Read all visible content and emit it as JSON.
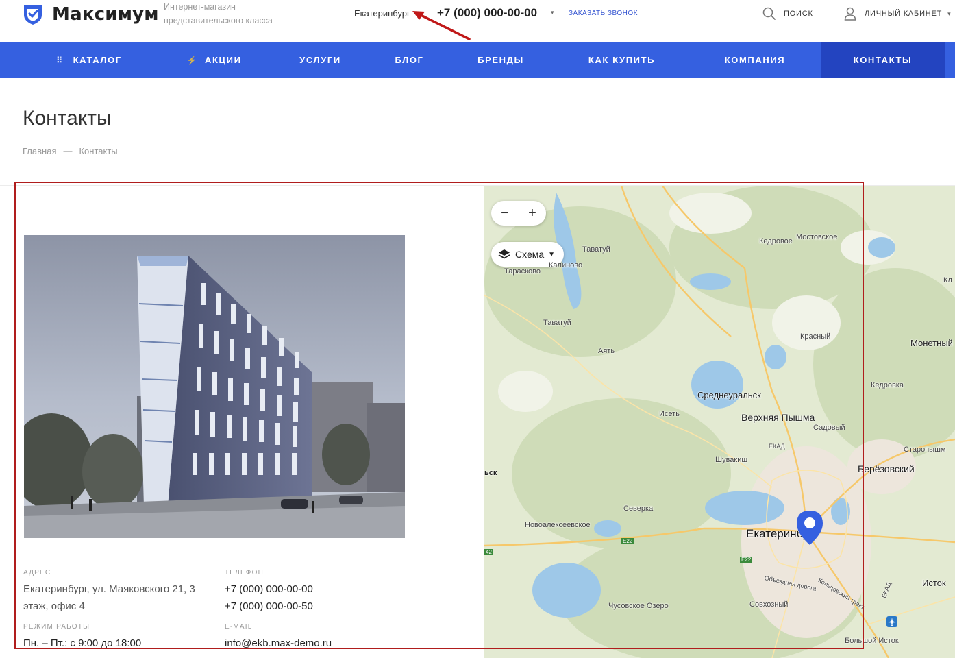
{
  "header": {
    "logo_text": "Максимум",
    "slogan": "Интернет-магазин представительского класса",
    "city": "Екатеринбург",
    "phone": "+7 (000) 000-00-00",
    "callback": "ЗАКАЗАТЬ ЗВОНОК",
    "search_label": "ПОИСК",
    "cabinet_label": "ЛИЧНЫЙ КАБИНЕТ",
    "brand_color": "#3560e0",
    "arrow_color": "#c01818"
  },
  "nav": {
    "items": [
      {
        "label": "КАТАЛОГ",
        "icon": "grid-icon"
      },
      {
        "label": "АКЦИИ",
        "icon": "lightning-icon"
      },
      {
        "label": "УСЛУГИ"
      },
      {
        "label": "БЛОГ"
      },
      {
        "label": "БРЕНДЫ"
      },
      {
        "label": "КАК КУПИТЬ"
      },
      {
        "label": "КОМПАНИЯ"
      },
      {
        "label": "КОНТАКТЫ",
        "active": true
      }
    ]
  },
  "page": {
    "title": "Контакты",
    "breadcrumb": [
      "Главная",
      "—",
      "Контакты"
    ]
  },
  "contacts": {
    "address_label": "АДРЕС",
    "address_line1": "Екатеринбург, ул. Маяковского 21, 3",
    "address_line2": "этаж, офис 4",
    "phone_label": "ТЕЛЕФОН",
    "phone1": "+7 (000) 000-00-00",
    "phone2": "+7 (000) 000-00-50",
    "hours_label": "РЕЖИМ РАБОТЫ",
    "hours": "Пн. – Пт.: с 9:00 до 18:00",
    "email_label": "E-MAIL",
    "email": "info@ekb.max-demo.ru"
  },
  "map": {
    "zoom_out": "−",
    "zoom_in": "+",
    "layer_label": "Схема",
    "labels": {
      "tavatuy1": "Таватуй",
      "kalinovo": "Калиново",
      "taraskovo": "Тарасково",
      "tavatuy2": "Таватуй",
      "ayat": "Аять",
      "kedrovoe": "Кедровое",
      "mostovskoe": "Мостовское",
      "kl": "Кл",
      "krasny": "Красный",
      "monetny": "Монетный",
      "sredneuralsk": "Среднеуральск",
      "kedrovka": "Кедровка",
      "iset": "Исеть",
      "vpyshma": "Верхняя Пышма",
      "sadovy": "Садовый",
      "ekad": "ЕКАД",
      "staropyshminsk": "Старопышм",
      "sk": "ьск",
      "shuvakish": "Шувакиш",
      "berezovsky": "Берёзовский",
      "severka": "Северка",
      "novoalekseevskoe": "Новоалексеевское",
      "ekaterinburg": "Екатеринбург",
      "e22a": "E22",
      "e22b": "E22",
      "n42": "42",
      "istok": "Исток",
      "chusovskoe": "Чусовское Озеро",
      "sovkhozny": "Совхозный",
      "bistok": "Большой Исток",
      "obezdnaya": "Объездная дорога",
      "koltsovsky": "Кольцовский тракт",
      "ekad2": "ЕКАД"
    }
  }
}
